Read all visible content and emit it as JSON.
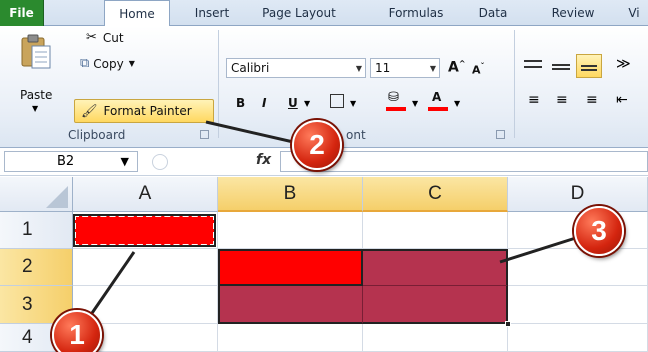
{
  "ribbon": {
    "tabs": [
      "File",
      "Home",
      "Insert",
      "Page Layout",
      "Formulas",
      "Data",
      "Review",
      "Vi"
    ],
    "clipboard": {
      "paste_label": "Paste",
      "cut_label": "Cut",
      "copy_label": "Copy",
      "format_painter_label": "Format Painter",
      "group_label": "Clipboard"
    },
    "font": {
      "font_name": "Calibri",
      "font_size": "11",
      "group_label_partial": "ont",
      "bold": "B",
      "italic": "I",
      "underline": "U",
      "font_color_letter": "A"
    }
  },
  "formula_bar": {
    "name_box_value": "B2",
    "fx_label": "fx",
    "formula_value": ""
  },
  "grid": {
    "columns": [
      "A",
      "B",
      "C",
      "D"
    ],
    "rows": [
      "1",
      "2",
      "3",
      "4"
    ],
    "selected_columns": [
      "B",
      "C"
    ],
    "selected_rows": [
      "2",
      "3"
    ],
    "cells": {
      "A1": {
        "fill": "#ff0000",
        "copy_marquee": true
      },
      "B2": {
        "fill": "#ff0000"
      },
      "C2": {
        "fill": "#b5334f"
      },
      "B3": {
        "fill": "#b5334f"
      },
      "C3": {
        "fill": "#b5334f"
      }
    }
  },
  "callouts": [
    {
      "number": "1",
      "target": "A1"
    },
    {
      "number": "2",
      "target": "Format Painter"
    },
    {
      "number": "3",
      "target": "B2:C3"
    }
  ],
  "colors": {
    "file_tab": "#2b8a2e",
    "callout": "#d4250f",
    "highlight": "#f5cf6a"
  }
}
